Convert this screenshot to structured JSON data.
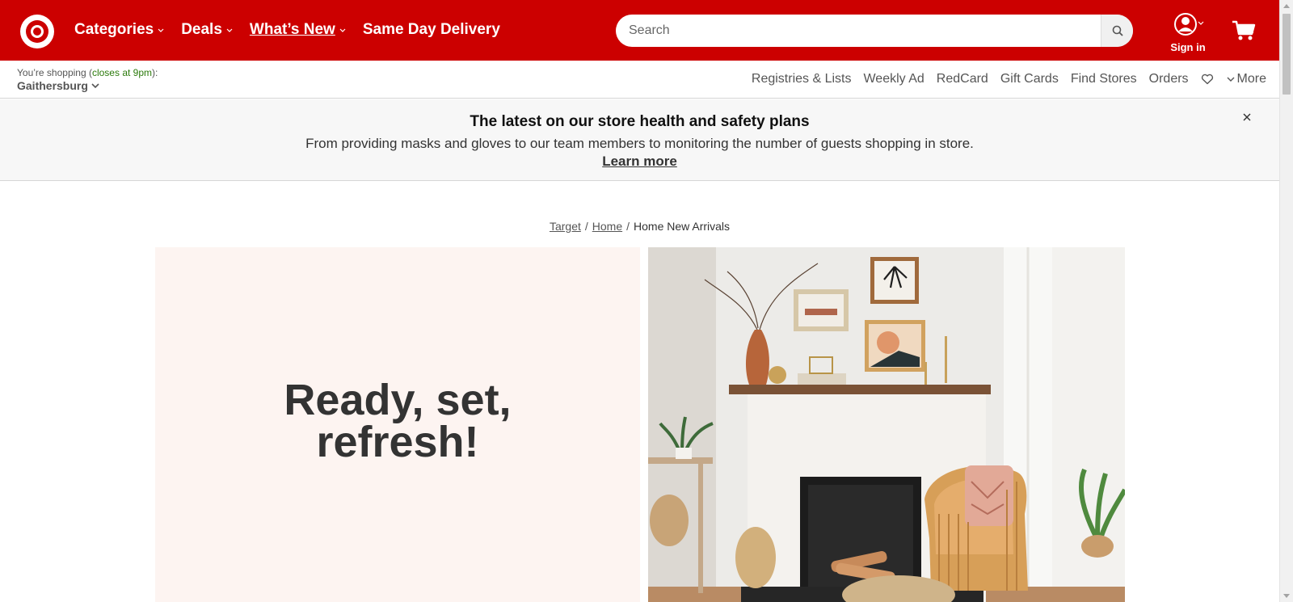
{
  "header": {
    "logo": "target-bullseye-icon",
    "nav": [
      {
        "label": "Categories",
        "has_menu": true
      },
      {
        "label": "Deals",
        "has_menu": true
      },
      {
        "label": "What’s New",
        "has_menu": true
      },
      {
        "label": "Same Day Delivery",
        "has_menu": false
      }
    ],
    "search_placeholder": "Search",
    "account_label": "Sign in",
    "brand_color": "#cc0000"
  },
  "store": {
    "prefix": "You’re shopping (",
    "closes": "closes at 9pm",
    "suffix": "):",
    "name": "Gaithersburg"
  },
  "utility_links": [
    "Registries & Lists",
    "Weekly Ad",
    "RedCard",
    "Gift Cards",
    "Find Stores",
    "Orders"
  ],
  "utility_more": "More",
  "banner": {
    "title": "The latest on our store health and safety plans",
    "description": "From providing masks and gloves to our team members to monitoring the number of guests shopping in store.",
    "link": "Learn more"
  },
  "breadcrumb": {
    "items": [
      "Target",
      "Home"
    ],
    "current": "Home New Arrivals"
  },
  "hero": {
    "headline": "Ready, set, refresh!",
    "panel_color": "#fdf4f1"
  }
}
